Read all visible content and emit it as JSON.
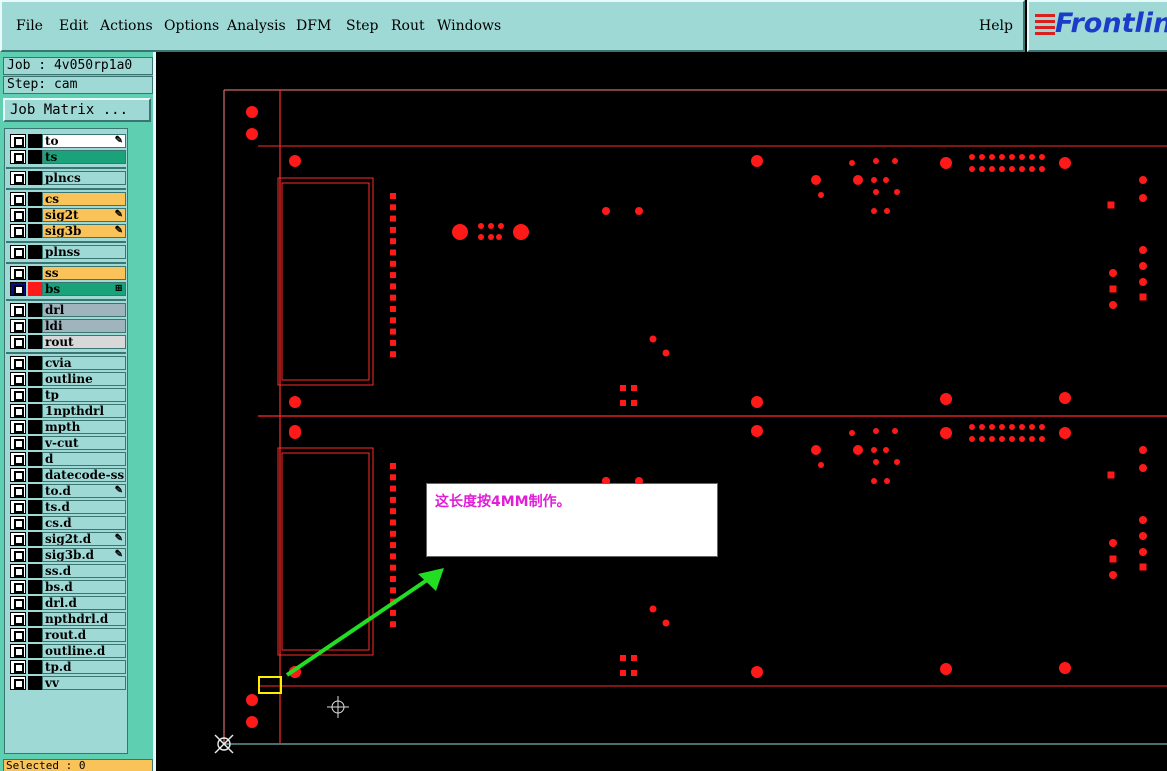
{
  "menu": {
    "file": "File",
    "edit": "Edit",
    "actions": "Actions",
    "options": "Options",
    "analysis": "Analysis",
    "dfm": "DFM",
    "step": "Step",
    "rout": "Rout",
    "windows": "Windows",
    "help": "Help"
  },
  "logo": {
    "text": "Frontlin"
  },
  "job": {
    "job_line": "Job : 4v050rp1a0",
    "step_line": "Step: cam",
    "matrix_label": "Job Matrix ..."
  },
  "layers": [
    {
      "name": "to",
      "color": "#ffffff",
      "mark": "✎"
    },
    {
      "name": "ts",
      "color": "#1aa37a",
      "mark": ""
    },
    {
      "name": "plncs",
      "color": "#9ed9d6",
      "mark": ""
    },
    {
      "name": "cs",
      "color": "#f9c35a",
      "mark": ""
    },
    {
      "name": "sig2t",
      "color": "#f9c35a",
      "mark": "✎"
    },
    {
      "name": "sig3b",
      "color": "#f9c35a",
      "mark": "✎"
    },
    {
      "name": "plnss",
      "color": "#9ed9d6",
      "mark": ""
    },
    {
      "name": "ss",
      "color": "#f9c35a",
      "mark": ""
    },
    {
      "name": "bs",
      "color": "#1aa37a",
      "mark": "⊞"
    },
    {
      "name": "drl",
      "color": "#9fb4bc",
      "mark": ""
    },
    {
      "name": "ldi",
      "color": "#9fb4bc",
      "mark": ""
    },
    {
      "name": "rout",
      "color": "#d8d8d8",
      "mark": ""
    },
    {
      "name": "cvia",
      "color": "#9ed9d6",
      "mark": ""
    },
    {
      "name": "outline",
      "color": "#9ed9d6",
      "mark": ""
    },
    {
      "name": "tp",
      "color": "#9ed9d6",
      "mark": ""
    },
    {
      "name": "1npthdrl",
      "color": "#9ed9d6",
      "mark": ""
    },
    {
      "name": "mpth",
      "color": "#9ed9d6",
      "mark": ""
    },
    {
      "name": "v-cut",
      "color": "#9ed9d6",
      "mark": ""
    },
    {
      "name": "d",
      "color": "#9ed9d6",
      "mark": ""
    },
    {
      "name": "datecode-ss",
      "color": "#9ed9d6",
      "mark": ""
    },
    {
      "name": "to.d",
      "color": "#9ed9d6",
      "mark": "✎"
    },
    {
      "name": "ts.d",
      "color": "#9ed9d6",
      "mark": ""
    },
    {
      "name": "cs.d",
      "color": "#9ed9d6",
      "mark": ""
    },
    {
      "name": "sig2t.d",
      "color": "#9ed9d6",
      "mark": "✎"
    },
    {
      "name": "sig3b.d",
      "color": "#9ed9d6",
      "mark": "✎"
    },
    {
      "name": "ss.d",
      "color": "#9ed9d6",
      "mark": ""
    },
    {
      "name": "bs.d",
      "color": "#9ed9d6",
      "mark": ""
    },
    {
      "name": "drl.d",
      "color": "#9ed9d6",
      "mark": ""
    },
    {
      "name": "npthdrl.d",
      "color": "#9ed9d6",
      "mark": ""
    },
    {
      "name": "rout.d",
      "color": "#9ed9d6",
      "mark": ""
    },
    {
      "name": "outline.d",
      "color": "#9ed9d6",
      "mark": ""
    },
    {
      "name": "tp.d",
      "color": "#9ed9d6",
      "mark": ""
    },
    {
      "name": "vv",
      "color": "#9ed9d6",
      "mark": ""
    }
  ],
  "active_layer": "bs",
  "status": {
    "selected": "Selected : 0"
  },
  "note": {
    "text": "这长度按4MM制作。"
  },
  "colors": {
    "pad": "#ff1a1a",
    "line": "#ff2a2a",
    "arrow": "#22dd22",
    "highlight": "#ffee00",
    "note_text": "#e01ed8"
  }
}
